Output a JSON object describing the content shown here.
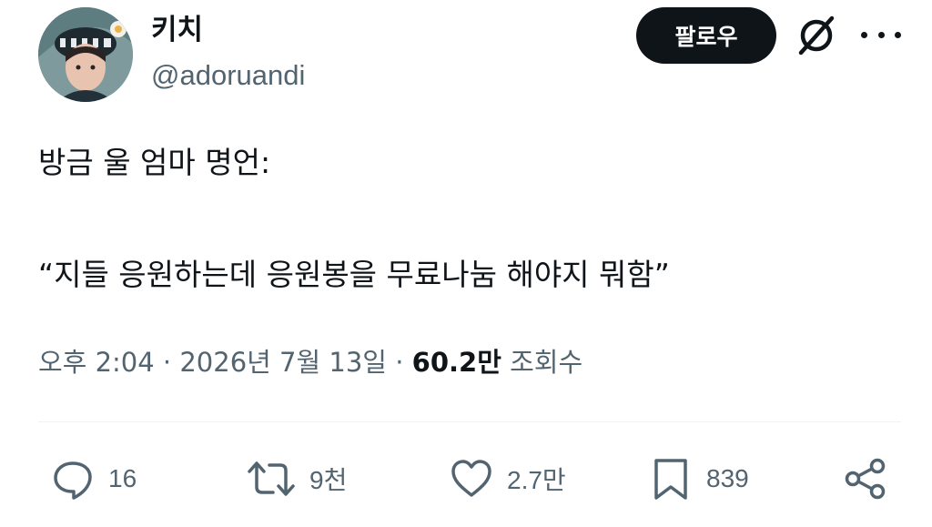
{
  "author": {
    "name": "키치",
    "handle": "@adoruandi"
  },
  "follow_label": "팔로우",
  "icons": {
    "grok": "grok-icon",
    "more": "more-icon"
  },
  "tweet": {
    "line1": "방금 울 엄마 명언:",
    "line2": "“지들 응원하는데 응원봉을 무료나눔 해야지 뭐함”"
  },
  "meta": {
    "timestamp": "오후 2:04 · 2026년 7월 13일 · ",
    "views_count": "60.2만",
    "views_label": " 조회수"
  },
  "actions": {
    "replies": "16",
    "retweets": "9천",
    "likes": "2.7만",
    "bookmarks": "839"
  },
  "colors": {
    "primary_text": "#0f1419",
    "secondary_text": "#536471",
    "divider": "#eff3f4"
  }
}
